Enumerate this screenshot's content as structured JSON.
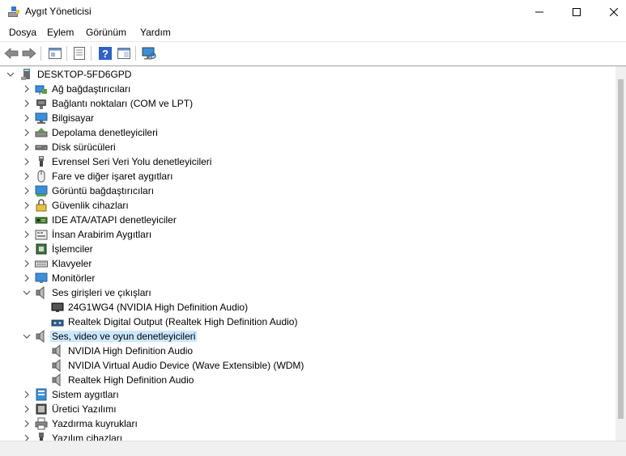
{
  "window": {
    "title": "Aygıt Yöneticisi"
  },
  "menu": [
    "Dosya",
    "Eylem",
    "Görünüm",
    "Yardım"
  ],
  "tree": {
    "root": "DESKTOP-5FD6GPD",
    "items": [
      {
        "label": "Ağ bağdaştırıcıları",
        "icon": "network-adapter-icon",
        "level": 1,
        "expanded": false
      },
      {
        "label": "Bağlantı noktaları (COM ve LPT)",
        "icon": "port-icon",
        "level": 1,
        "expanded": false
      },
      {
        "label": "Bilgisayar",
        "icon": "computer-icon",
        "level": 1,
        "expanded": false
      },
      {
        "label": "Depolama denetleyicileri",
        "icon": "storage-controller-icon",
        "level": 1,
        "expanded": false
      },
      {
        "label": "Disk sürücüleri",
        "icon": "disk-drive-icon",
        "level": 1,
        "expanded": false
      },
      {
        "label": "Evrensel Seri Veri Yolu denetleyicileri",
        "icon": "usb-icon",
        "level": 1,
        "expanded": false
      },
      {
        "label": "Fare ve diğer işaret aygıtları",
        "icon": "mouse-icon",
        "level": 1,
        "expanded": false
      },
      {
        "label": "Görüntü bağdaştırıcıları",
        "icon": "display-adapter-icon",
        "level": 1,
        "expanded": false
      },
      {
        "label": "Güvenlik cihazları",
        "icon": "security-device-icon",
        "level": 1,
        "expanded": false
      },
      {
        "label": "IDE ATA/ATAPI denetleyiciler",
        "icon": "ide-controller-icon",
        "level": 1,
        "expanded": false
      },
      {
        "label": "İnsan Arabirim Aygıtları",
        "icon": "hid-icon",
        "level": 1,
        "expanded": false
      },
      {
        "label": "İşlemciler",
        "icon": "processor-icon",
        "level": 1,
        "expanded": false
      },
      {
        "label": "Klavyeler",
        "icon": "keyboard-icon",
        "level": 1,
        "expanded": false
      },
      {
        "label": "Monitörler",
        "icon": "monitor-icon",
        "level": 1,
        "expanded": false
      },
      {
        "label": "Ses girişleri ve çıkışları",
        "icon": "speaker-icon",
        "level": 1,
        "expanded": true
      },
      {
        "label": "24G1WG4 (NVIDIA High Definition Audio)",
        "icon": "monitor-audio-icon",
        "level": 2
      },
      {
        "label": "Realtek Digital Output (Realtek High Definition Audio)",
        "icon": "digital-output-icon",
        "level": 2
      },
      {
        "label": "Ses, video ve oyun denetleyicileri",
        "icon": "speaker-icon",
        "level": 1,
        "expanded": true,
        "selected": true
      },
      {
        "label": "NVIDIA High Definition Audio",
        "icon": "speaker-icon",
        "level": 2
      },
      {
        "label": "NVIDIA Virtual Audio Device (Wave Extensible) (WDM)",
        "icon": "speaker-icon",
        "level": 2
      },
      {
        "label": "Realtek High Definition Audio",
        "icon": "speaker-icon",
        "level": 2
      },
      {
        "label": "Sistem aygıtları",
        "icon": "system-device-icon",
        "level": 1,
        "expanded": false
      },
      {
        "label": "Üretici Yazılımı",
        "icon": "firmware-icon",
        "level": 1,
        "expanded": false
      },
      {
        "label": "Yazdırma kuyrukları",
        "icon": "printer-icon",
        "level": 1,
        "expanded": false
      },
      {
        "label": "Yazılım cihazları",
        "icon": "software-device-icon",
        "level": 1,
        "expanded": false
      }
    ]
  },
  "colors": {
    "selection": "#cce8ff",
    "accent": "#0078d7"
  }
}
